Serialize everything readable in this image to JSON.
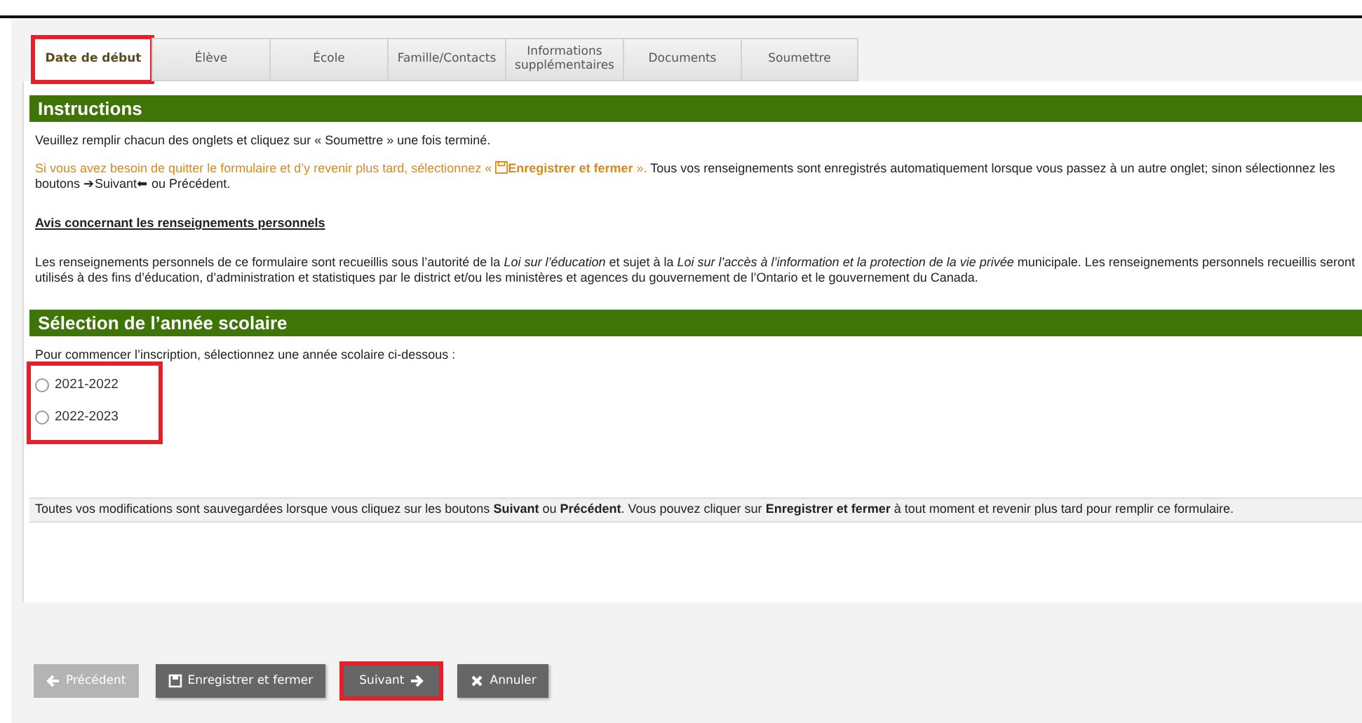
{
  "tabs": [
    {
      "label": "Date de début",
      "selected": true,
      "highlighted": true
    },
    {
      "label": "Élève",
      "selected": false,
      "highlighted": false
    },
    {
      "label": "École",
      "selected": false,
      "highlighted": false
    },
    {
      "label": "Famille/Contacts",
      "selected": false,
      "highlighted": false
    },
    {
      "label": "Informations supplémentaires",
      "selected": false,
      "highlighted": false
    },
    {
      "label": "Documents",
      "selected": false,
      "highlighted": false
    },
    {
      "label": "Soumettre",
      "selected": false,
      "highlighted": false
    }
  ],
  "instructions": {
    "title": "Instructions",
    "intro": "Veuillez remplir chacun des onglets et cliquez sur « Soumettre » une fois terminé.",
    "save_notice": {
      "before": "Si vous avez besoin de quitter le formulaire et d’y revenir plus tard, sélectionnez « ",
      "after": "**Enregistrer et fermer** ».",
      "rest": "Tous vos renseignements sont enregistrés automatiquement lorsque vous passez à un autre onglet; sinon sélectionnez les boutons ➔Suivant⬅ ou Précédent."
    },
    "privacy_heading": "Avis concernant les renseignements personnels",
    "privacy_text": "Les renseignements personnels de ce formulaire sont recueillis sous l’autorité de la *Loi sur l’éducation* et sujet à la *Loi sur l’accès à l’information et la protection de la vie privée* municipale. Les renseignements personnels recueillis seront utilisés à des fins d’éducation, d’administration et statistiques par le district et/ou les ministères et agences du gouvernement de l’Ontario et le gouvernement du Canada."
  },
  "year_selection": {
    "title": "Sélection de l’année scolaire",
    "prompt": "Pour commencer l’inscription, sélectionnez une année scolaire ci-dessous :",
    "highlighted": true,
    "options": [
      {
        "label": "2021-2022",
        "selected": false
      },
      {
        "label": "2022-2023",
        "selected": false
      }
    ]
  },
  "footer_note": "Toutes vos modifications sont sauvegardées lorsque vous cliquez sur les boutons **Suivant** ou **Précédent**. Vous pouvez cliquer sur **Enregistrer et fermer** à tout moment et revenir plus tard pour remplir ce formulaire.",
  "buttons": [
    {
      "label": "Précédent",
      "kind": "back",
      "disabled": true,
      "highlighted": false
    },
    {
      "label": "Enregistrer et fermer",
      "kind": "save",
      "disabled": false,
      "highlighted": false
    },
    {
      "label": "Suivant",
      "kind": "next",
      "disabled": false,
      "highlighted": true
    },
    {
      "label": "Annuler",
      "kind": "cancel",
      "disabled": false,
      "highlighted": false
    }
  ]
}
